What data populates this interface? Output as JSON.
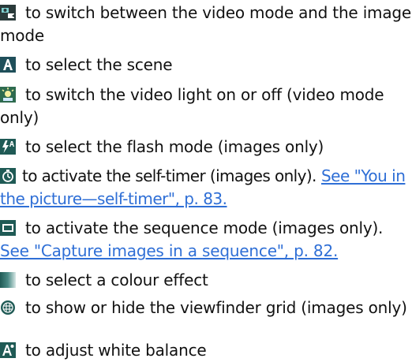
{
  "items": [
    {
      "icon": "video-image-switch-icon",
      "text": "to switch between the video mode and the image mode"
    },
    {
      "icon": "scene-icon",
      "text": "to select the scene"
    },
    {
      "icon": "video-light-icon",
      "text": "to switch the video light on or off (video mode only)"
    },
    {
      "icon": "flash-mode-icon",
      "text": "to select the flash mode (images only)"
    },
    {
      "icon": "self-timer-icon",
      "text": "to activate the self-timer (images only).",
      "link": "See \"You in the picture—self-timer\", p. 83."
    },
    {
      "icon": "sequence-mode-icon",
      "text": "to activate the sequence mode (images only).",
      "link": "See \"Capture images in a sequence\", p. 82."
    },
    {
      "icon": "colour-effect-icon",
      "text": "to select a colour effect"
    },
    {
      "icon": "viewfinder-grid-icon",
      "text": "to show or hide the viewfinder grid (images only)"
    },
    {
      "icon": "white-balance-icon",
      "text": "to adjust white balance"
    }
  ],
  "colors": {
    "text": "#111111",
    "link": "#2f6fd6",
    "icon_dark": "#2a3a3a",
    "icon_teal": "#1f7a7a"
  }
}
